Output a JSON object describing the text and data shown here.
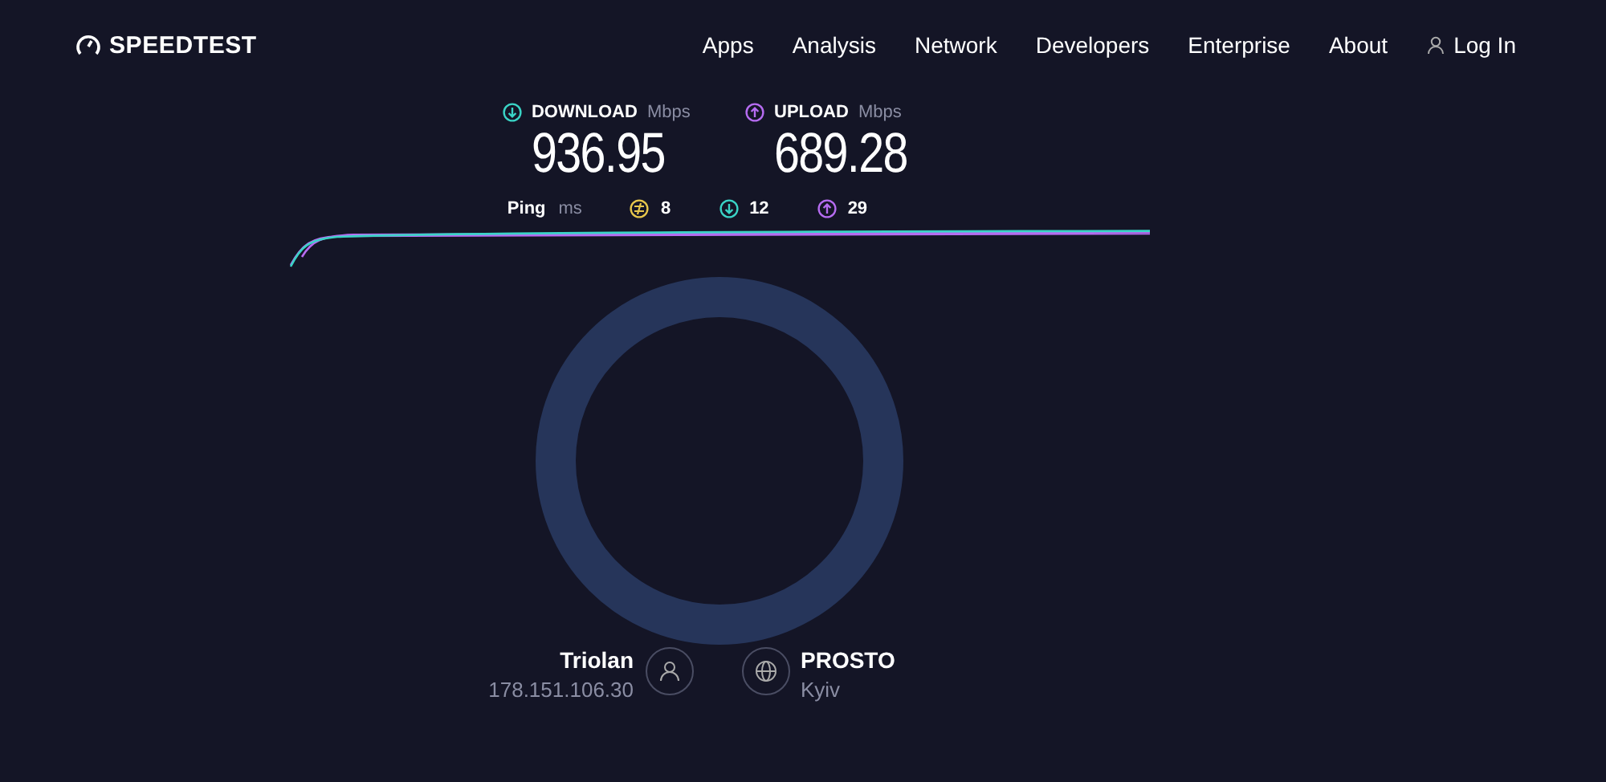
{
  "header": {
    "logo": "SPEEDTEST",
    "nav": [
      "Apps",
      "Analysis",
      "Network",
      "Developers",
      "Enterprise",
      "About"
    ],
    "login": "Log In"
  },
  "results": [
    {
      "kind": "download",
      "label": "DOWNLOAD",
      "unit": "Mbps",
      "value": "936.95"
    },
    {
      "kind": "upload",
      "label": "UPLOAD",
      "unit": "Mbps",
      "value": "689.28"
    }
  ],
  "ping": {
    "label": "Ping",
    "unit": "ms",
    "items": [
      {
        "kind": "idle",
        "value": "8"
      },
      {
        "kind": "download",
        "value": "12"
      },
      {
        "kind": "upload",
        "value": "29"
      }
    ]
  },
  "provider": {
    "name": "Triolan",
    "ip": "178.151.106.30"
  },
  "server": {
    "name": "PROSTO",
    "location": "Kyiv"
  }
}
